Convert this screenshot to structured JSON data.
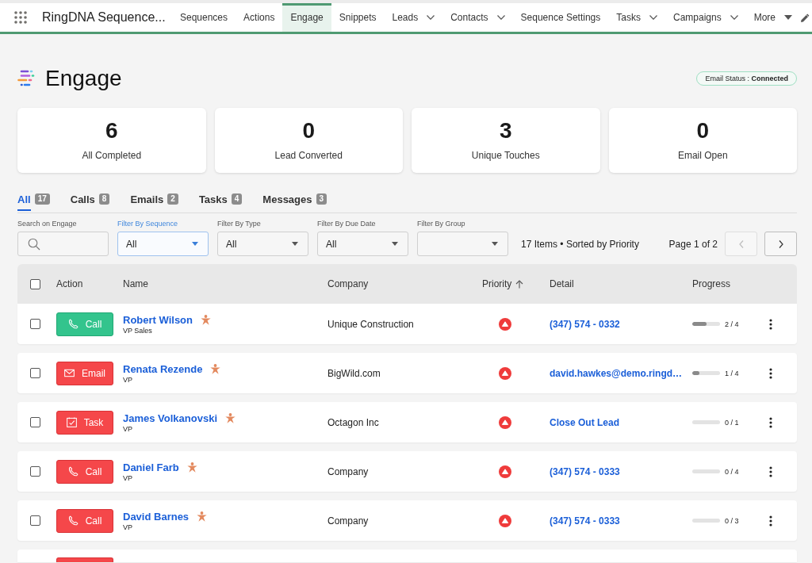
{
  "nav": {
    "app_name": "RingDNA Sequence...",
    "items": [
      {
        "label": "Sequences",
        "selected": false,
        "kind": "plain"
      },
      {
        "label": "Actions",
        "selected": false,
        "kind": "plain"
      },
      {
        "label": "Engage",
        "selected": true,
        "kind": "plain"
      },
      {
        "label": "Snippets",
        "selected": false,
        "kind": "plain"
      },
      {
        "label": "Leads",
        "selected": false,
        "kind": "menu"
      },
      {
        "label": "Contacts",
        "selected": false,
        "kind": "menu"
      },
      {
        "label": "Sequence Settings",
        "selected": false,
        "kind": "plain"
      },
      {
        "label": "Tasks",
        "selected": false,
        "kind": "menu"
      },
      {
        "label": "Campaigns",
        "selected": false,
        "kind": "menu"
      },
      {
        "label": "More",
        "selected": false,
        "kind": "more"
      }
    ]
  },
  "header": {
    "title": "Engage",
    "email_status": "Email Status : **Connected**"
  },
  "stats": [
    {
      "value": "6",
      "label": "All Completed"
    },
    {
      "value": "0",
      "label": "Lead Converted"
    },
    {
      "value": "3",
      "label": "Unique Touches"
    },
    {
      "value": "0",
      "label": "Email Open"
    }
  ],
  "tabs": [
    {
      "label": "All",
      "count": "17",
      "selected": true
    },
    {
      "label": "Calls",
      "count": "8",
      "selected": false
    },
    {
      "label": "Emails",
      "count": "2",
      "selected": false
    },
    {
      "label": "Tasks",
      "count": "4",
      "selected": false
    },
    {
      "label": "Messages",
      "count": "3",
      "selected": false
    }
  ],
  "filters": {
    "search": {
      "label": "Search on Engage"
    },
    "selects": [
      {
        "label": "Filter By Sequence",
        "value": "All",
        "focused": true
      },
      {
        "label": "Filter By Type",
        "value": "All",
        "focused": false
      },
      {
        "label": "Filter By Due Date",
        "value": "All",
        "focused": false
      },
      {
        "label": "Filter By Group",
        "focused": false
      }
    ]
  },
  "summary": "17 Items • Sorted by Priority",
  "pager": {
    "label": "Page 1 of 2",
    "prev": {
      "disabled": true
    },
    "next": {
      "disabled": false
    }
  },
  "table": {
    "select_all": {
      "checked": false
    },
    "columns": [
      {
        "label": "Action",
        "sorted": false
      },
      {
        "label": "Name",
        "sorted": false
      },
      {
        "label": "Company",
        "sorted": false
      },
      {
        "label": "Priority",
        "sorted": true
      },
      {
        "label": "Detail",
        "sorted": false
      },
      {
        "label": "Progress",
        "sorted": false
      }
    ],
    "rows": [
      {
        "checked": false,
        "action": {
          "kind": "call",
          "label": "Call",
          "overdue": false
        },
        "name": "Robert Wilson",
        "title": "VP Sales",
        "company": "Unique Construction",
        "high_priority": true,
        "detail": "(347) 574 - 0332",
        "level": 0.5,
        "progress": "2 / 4"
      },
      {
        "checked": false,
        "action": {
          "kind": "email",
          "label": "Email",
          "overdue": true
        },
        "name": "Renata Rezende",
        "title": "VP",
        "company": "BigWild.com",
        "high_priority": true,
        "detail": "david.hawkes@demo.ringd…",
        "level": 0.25,
        "progress": "1 / 4"
      },
      {
        "checked": false,
        "action": {
          "kind": "task",
          "label": "Task",
          "overdue": true
        },
        "name": "James Volkanovski",
        "title": "VP",
        "company": "Octagon Inc",
        "high_priority": true,
        "detail": "Close Out Lead",
        "level": 0,
        "progress": "0 / 1"
      },
      {
        "checked": false,
        "action": {
          "kind": "call",
          "label": "Call",
          "overdue": true
        },
        "name": "Daniel Farb",
        "title": "VP",
        "company": "Company",
        "high_priority": true,
        "detail": "(347) 574 - 0333",
        "level": 0,
        "progress": "0 / 4"
      },
      {
        "checked": false,
        "action": {
          "kind": "call",
          "label": "Call",
          "overdue": true
        },
        "name": "David Barnes",
        "title": "VP",
        "company": "Company",
        "high_priority": true,
        "detail": "(347) 574 - 0333",
        "level": 0,
        "progress": "0 / 3"
      },
      {
        "action": {
          "overdue": true
        }
      }
    ]
  }
}
